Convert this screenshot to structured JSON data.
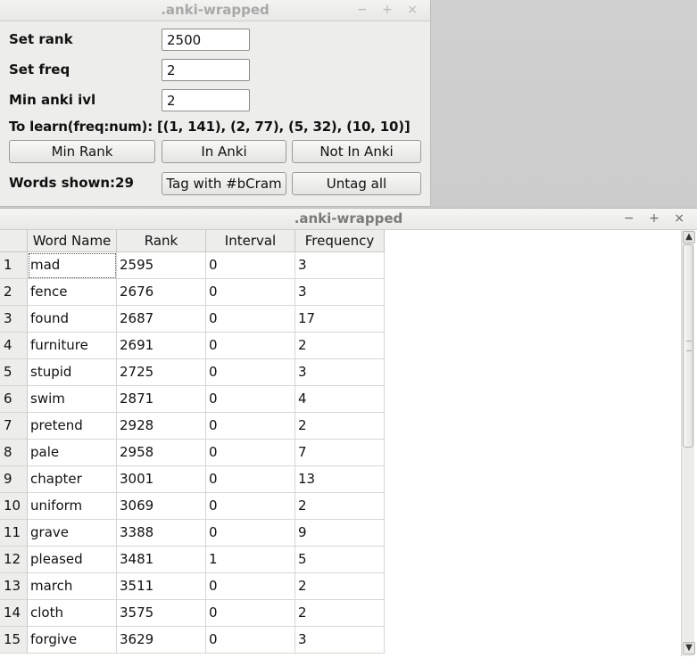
{
  "top_window": {
    "title": ".anki-wrapped",
    "controls": "− + ×",
    "set_rank_label": "Set rank",
    "set_rank_value": "2500",
    "set_freq_label": "Set freq",
    "set_freq_value": "2",
    "min_ivl_label": "Min anki ivl",
    "min_ivl_value": "2",
    "to_learn_text": "To learn(freq:num): [(1, 141), (2, 77), (5, 32), (10, 10)]",
    "btn_min_rank": "Min Rank",
    "btn_in_anki": "In Anki",
    "btn_not_in_anki": "Not In Anki",
    "words_shown": "Words shown:29",
    "btn_tag": "Tag with #bCram",
    "btn_untag": "Untag all"
  },
  "bottom_window": {
    "title": ".anki-wrapped",
    "controls": "− + ×",
    "columns": [
      "Word Name",
      "Rank",
      "Interval",
      "Frequency"
    ],
    "rows": [
      {
        "n": "1",
        "word": "mad",
        "rank": "2595",
        "interval": "0",
        "freq": "3"
      },
      {
        "n": "2",
        "word": "fence",
        "rank": "2676",
        "interval": "0",
        "freq": "3"
      },
      {
        "n": "3",
        "word": "found",
        "rank": "2687",
        "interval": "0",
        "freq": "17"
      },
      {
        "n": "4",
        "word": "furniture",
        "rank": "2691",
        "interval": "0",
        "freq": "2"
      },
      {
        "n": "5",
        "word": "stupid",
        "rank": "2725",
        "interval": "0",
        "freq": "3"
      },
      {
        "n": "6",
        "word": "swim",
        "rank": "2871",
        "interval": "0",
        "freq": "4"
      },
      {
        "n": "7",
        "word": "pretend",
        "rank": "2928",
        "interval": "0",
        "freq": "2"
      },
      {
        "n": "8",
        "word": "pale",
        "rank": "2958",
        "interval": "0",
        "freq": "7"
      },
      {
        "n": "9",
        "word": "chapter",
        "rank": "3001",
        "interval": "0",
        "freq": "13"
      },
      {
        "n": "10",
        "word": "uniform",
        "rank": "3069",
        "interval": "0",
        "freq": "2"
      },
      {
        "n": "11",
        "word": "grave",
        "rank": "3388",
        "interval": "0",
        "freq": "9"
      },
      {
        "n": "12",
        "word": "pleased",
        "rank": "3481",
        "interval": "1",
        "freq": "5"
      },
      {
        "n": "13",
        "word": "march",
        "rank": "3511",
        "interval": "0",
        "freq": "2"
      },
      {
        "n": "14",
        "word": "cloth",
        "rank": "3575",
        "interval": "0",
        "freq": "2"
      },
      {
        "n": "15",
        "word": "forgive",
        "rank": "3629",
        "interval": "0",
        "freq": "3"
      }
    ],
    "scroll_up": "▲",
    "scroll_down": "▼"
  }
}
